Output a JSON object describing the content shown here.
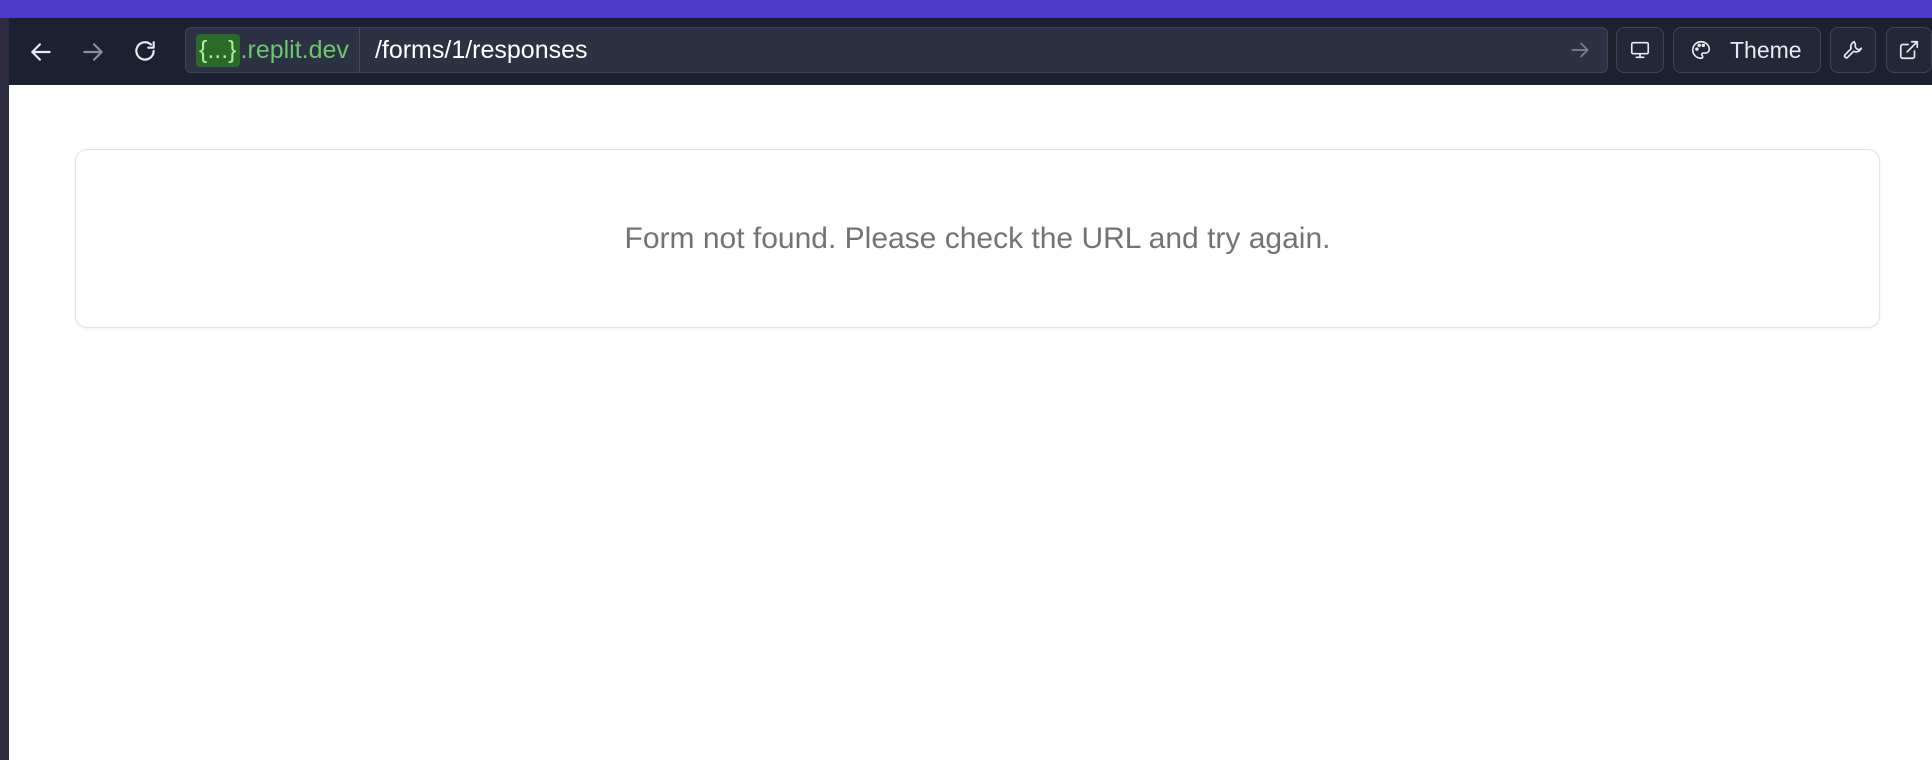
{
  "browser": {
    "url_host_badge": "{...}",
    "url_host": ".replit.dev",
    "url_path": "/forms/1/responses",
    "theme_label": "Theme"
  },
  "icons": {
    "back": "arrow-left-icon",
    "forward": "arrow-right-icon",
    "reload": "refresh-icon",
    "go": "arrow-right-icon",
    "device": "monitor-icon",
    "theme": "palette-icon",
    "devtools": "wrench-icon",
    "open_external": "external-link-icon"
  },
  "colors": {
    "accent": "#4f3ac7",
    "toolbar": "#1c2130",
    "host_text": "#6cc66a",
    "message_text": "#737373"
  },
  "page": {
    "message": "Form not found. Please check the URL and try again."
  }
}
